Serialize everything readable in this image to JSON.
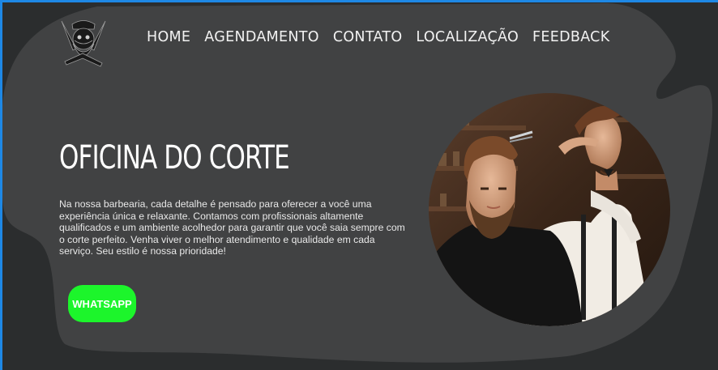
{
  "colors": {
    "background": "#2b2d2e",
    "panel": "#414243",
    "accent_green": "#1cf52b",
    "text": "#ffffff",
    "frame_border": "#1e88e5"
  },
  "header": {
    "logo_icon": "barber-skull-logo-icon",
    "nav_items": [
      {
        "label": "HOME"
      },
      {
        "label": "AGENDAMENTO"
      },
      {
        "label": "CONTATO"
      },
      {
        "label": "LOCALIZAÇÃO"
      },
      {
        "label": "FEEDBACK"
      }
    ]
  },
  "hero": {
    "title": "OFICINA DO CORTE",
    "description": "Na nossa barbearia, cada detalhe é pensado para oferecer a você uma experiência única e relaxante. Contamos com profissionais altamente qualificados e um ambiente acolhedor para garantir que você saia sempre com o corte perfeito. Venha viver o melhor atendimento e qualidade em cada serviço. Seu estilo é nossa prioridade!",
    "whatsapp_label": "WHATSAPP",
    "photo_icon": "barber-cutting-hair-photo"
  }
}
